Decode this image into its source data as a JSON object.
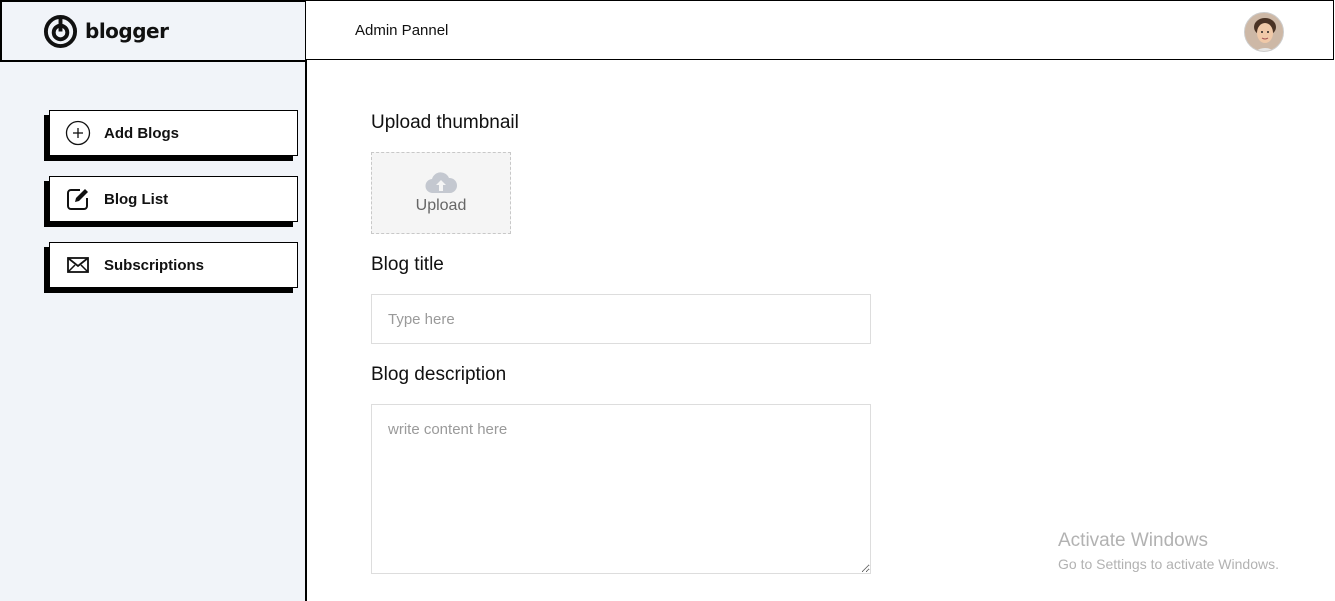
{
  "brand": {
    "name": "blogger",
    "icon": "blogger-logo-icon"
  },
  "header": {
    "title": "Admin Pannel",
    "avatar": "user-avatar"
  },
  "sidebar": {
    "items": [
      {
        "label": "Add Blogs",
        "icon": "plus-circle-icon"
      },
      {
        "label": "Blog List",
        "icon": "edit-icon"
      },
      {
        "label": "Subscriptions",
        "icon": "mail-icon"
      }
    ]
  },
  "form": {
    "thumbnail_label": "Upload thumbnail",
    "upload_label": "Upload",
    "title_label": "Blog title",
    "title_placeholder": "Type here",
    "description_label": "Blog description",
    "description_placeholder": "write content here"
  },
  "watermark": {
    "title": "Activate Windows",
    "subtitle": "Go to Settings to activate Windows."
  }
}
